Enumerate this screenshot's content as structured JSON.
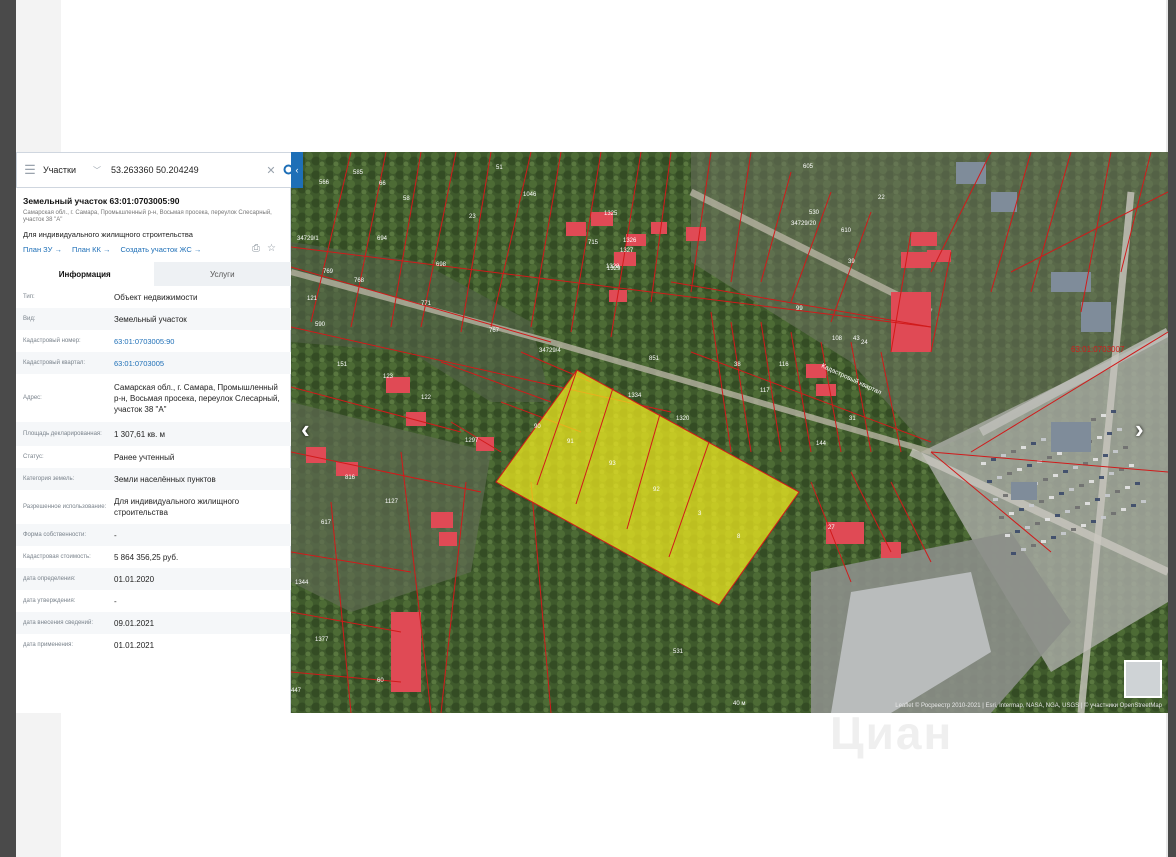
{
  "search": {
    "layer": "Участки",
    "query": "53.263360 50.204249"
  },
  "object": {
    "title": "Земельный участок 63:01:0703005:90",
    "address_short": "Самарская обл., г. Самара, Промышленный р-н, Восьмая просека, переулок Слесарный, участок 38 \"А\"",
    "purpose": "Для индивидуального жилищного строительства",
    "links": [
      "План ЗУ →",
      "План КК →",
      "Создать участок ЖС →"
    ]
  },
  "tabs": [
    "Информация",
    "Услуги"
  ],
  "rows": [
    {
      "k": "Тип:",
      "v": "Объект недвижимости"
    },
    {
      "k": "Вид:",
      "v": "Земельный участок"
    },
    {
      "k": "Кадастровый номер:",
      "v": "63:01:0703005:90",
      "link": true
    },
    {
      "k": "Кадастровый квартал:",
      "v": "63:01:0703005",
      "link": true
    },
    {
      "k": "Адрес:",
      "v": "Самарская обл., г. Самара, Промышленный р-н, Восьмая просека, переулок Слесарный, участок 38 \"А\""
    },
    {
      "k": "Площадь декларированная:",
      "v": "1 307,61 кв. м"
    },
    {
      "k": "Статус:",
      "v": "Ранее учтенный"
    },
    {
      "k": "Категория земель:",
      "v": "Земли населённых пунктов"
    },
    {
      "k": "Разрешенное использование:",
      "v": "Для индивидуального жилищного строительства"
    },
    {
      "k": "Форма собственности:",
      "v": "-"
    },
    {
      "k": "Кадастровая стоимость:",
      "v": "5 864 356,25 руб."
    },
    {
      "k": "дата определения:",
      "v": "01.01.2020"
    },
    {
      "k": "дата утверждения:",
      "v": "-"
    },
    {
      "k": "дата внесения сведений:",
      "v": "09.01.2021"
    },
    {
      "k": "дата применения:",
      "v": "01.01.2021"
    }
  ],
  "map": {
    "parcel_labels": [
      "566",
      "585",
      "66",
      "58",
      "1046",
      "51",
      "23",
      "1325",
      "1326",
      "1327",
      "1328",
      "1329",
      "715",
      "694",
      "34729/1",
      "769",
      "768",
      "698",
      "771",
      "767",
      "34729/4",
      "851",
      "1334",
      "1320",
      "121",
      "590",
      "151",
      "123",
      "122",
      "1297",
      "816",
      "1127",
      "617",
      "1344",
      "1377",
      "60",
      "447",
      "90",
      "91",
      "93",
      "92",
      "3",
      "8",
      "116",
      "38",
      "117",
      "144",
      "108",
      "24",
      "22",
      "34729/20",
      "530",
      "610",
      "605",
      "99",
      "31",
      "27",
      "43",
      "39",
      "531"
    ],
    "street_label": "Кадастровый квартал",
    "quarter_label": "63:01:0703007",
    "scale": "40 м",
    "attribution": "Leaflet © Росреестр 2010-2021 | Esri, Intermap, NASA, NGA, USGS | © участники OpenStreetMap"
  },
  "watermark": "Циан",
  "colors": {
    "accent": "#1e6fb7",
    "parcel_border": "#d11a1a",
    "selected_fill": "#f2ec1e",
    "roof": "#e04a55"
  }
}
